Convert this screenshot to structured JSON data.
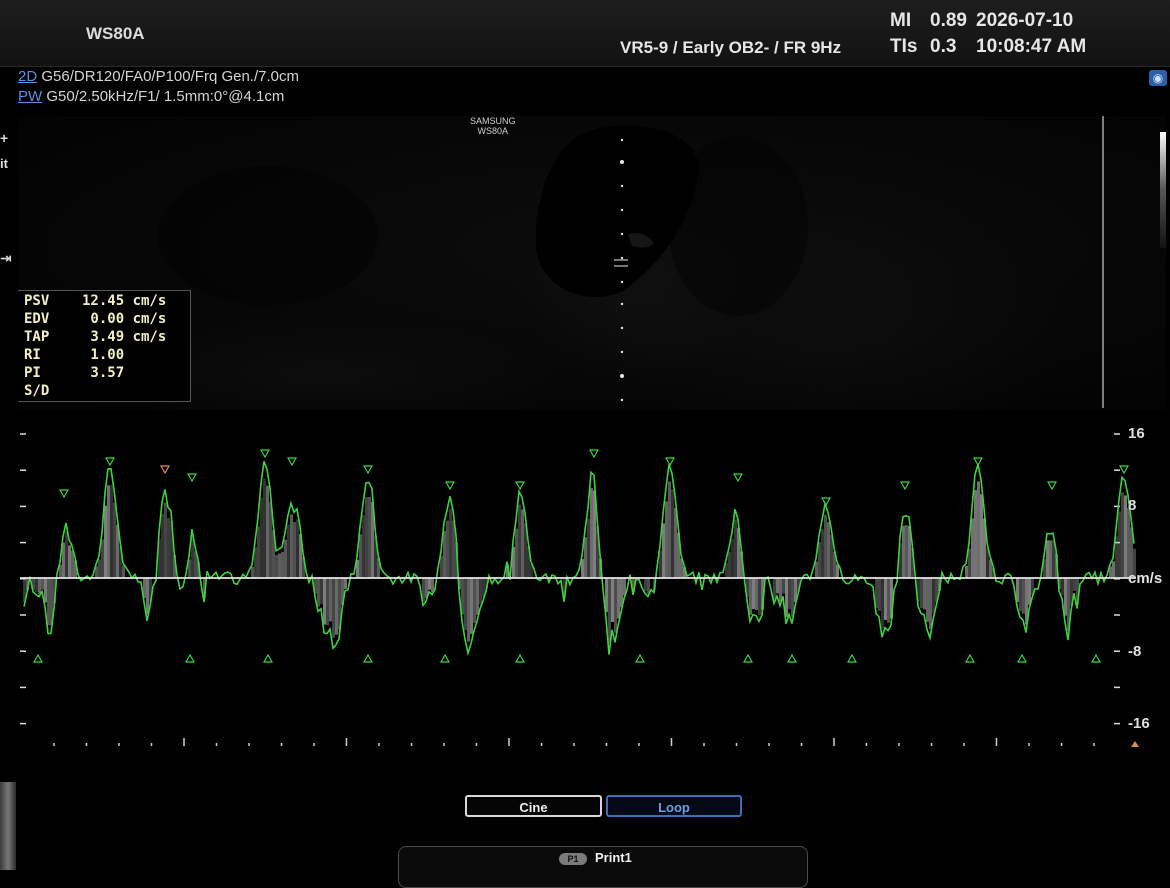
{
  "header": {
    "device": "WS80A",
    "preset": "VR5-9 / Early OB2- / FR 9Hz",
    "mi_label": "MI",
    "mi_value": "0.89",
    "tis_label": "TIs",
    "tis_value": "0.3",
    "date": "2026-07-10",
    "time": "10:08:47 AM"
  },
  "params": {
    "mode_2d": "2D",
    "line_2d": " G56/DR120/FA0/P100/Frq Gen./7.0cm",
    "mode_pw": "PW",
    "line_pw": " G50/2.50kHz/F1/ 1.5mm:0°@4.1cm"
  },
  "watermark": {
    "line1": "SAMSUNG",
    "line2": "WS80A"
  },
  "measurements": [
    {
      "label": "PSV",
      "value": "12.45 cm/s"
    },
    {
      "label": "EDV",
      "value": " 0.00 cm/s"
    },
    {
      "label": "TAP",
      "value": " 3.49 cm/s"
    },
    {
      "label": "RI",
      "value": " 1.00"
    },
    {
      "label": "PI",
      "value": " 3.57"
    },
    {
      "label": "S/D",
      "value": ""
    }
  ],
  "spectral_axis": {
    "unit": "cm/s",
    "ticks": [
      "16",
      "8",
      "-8",
      "-16"
    ]
  },
  "buttons": {
    "cine": "Cine",
    "loop": "Loop"
  },
  "print": {
    "badge": "P1",
    "label": "Print1"
  },
  "colors": {
    "trace": "#3fd23f",
    "accent": "#3d6fb8",
    "meas_text": "#f2efc6"
  }
}
